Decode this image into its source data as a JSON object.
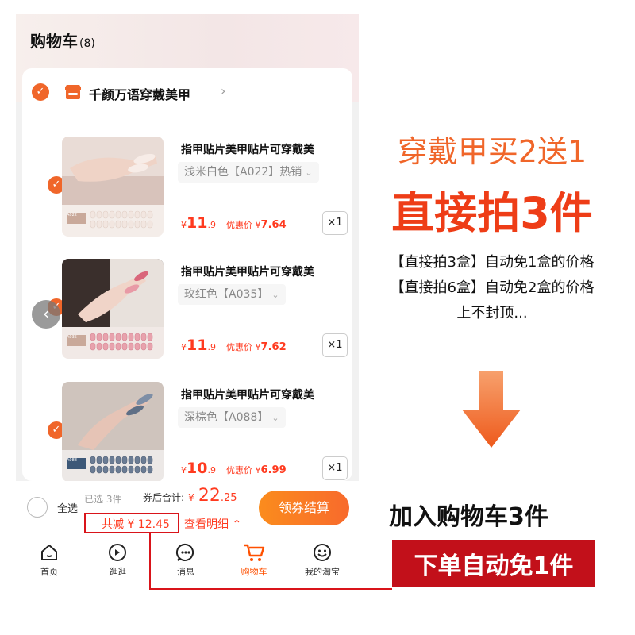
{
  "header": {
    "title": "购物车",
    "count": "(8)"
  },
  "shop": {
    "name": "千颜万语穿戴美甲"
  },
  "items": [
    {
      "title": "指甲贴片美甲贴片可穿戴美",
      "spec": "浅米白色【A022】热销",
      "price_int": "11",
      "price_dec": ".9",
      "discount_label": "优惠价",
      "discount_value": "7.64",
      "qty": "×1",
      "tag": "A022"
    },
    {
      "title": "指甲贴片美甲贴片可穿戴美",
      "spec": "玫红色【A035】",
      "price_int": "11",
      "price_dec": ".9",
      "discount_label": "优惠价",
      "discount_value": "7.62",
      "qty": "×1",
      "tag": "A035"
    },
    {
      "title": "指甲贴片美甲贴片可穿戴美",
      "spec": "深棕色【A088】",
      "price_int": "10",
      "price_dec": ".9",
      "discount_label": "优惠价",
      "discount_value": "6.99",
      "qty": "×1",
      "tag": "A088"
    }
  ],
  "currency": "¥",
  "checkout": {
    "select_all": "全选",
    "selected": "已选 3件",
    "total_label": "券后合计:",
    "total_int": "22",
    "total_dec": ".25",
    "saved": "共减 ¥ 12.45",
    "detail": "查看明细 ⌃",
    "pay_button": "领券结算"
  },
  "tabs": [
    {
      "label": "首页",
      "icon": "home-icon"
    },
    {
      "label": "逛逛",
      "icon": "browse-icon"
    },
    {
      "label": "消息",
      "icon": "message-icon"
    },
    {
      "label": "购物车",
      "icon": "cart-icon"
    },
    {
      "label": "我的淘宝",
      "icon": "profile-icon"
    }
  ],
  "active_tab": "购物车",
  "promo": {
    "line1": "穿戴甲买2送1",
    "line2": "直接拍3件",
    "notes": [
      "【直接拍3盒】自动免1盒的价格",
      "【直接拍6盒】自动免2盒的价格",
      "上不封顶..."
    ],
    "add_to_cart": "加入购物车3件",
    "auto_free": "下单自动免1件"
  },
  "colors": {
    "accent": "#f0662a",
    "price": "#ff3a1f",
    "annotation_red": "#d9141a",
    "banner_red": "#c2101a"
  }
}
